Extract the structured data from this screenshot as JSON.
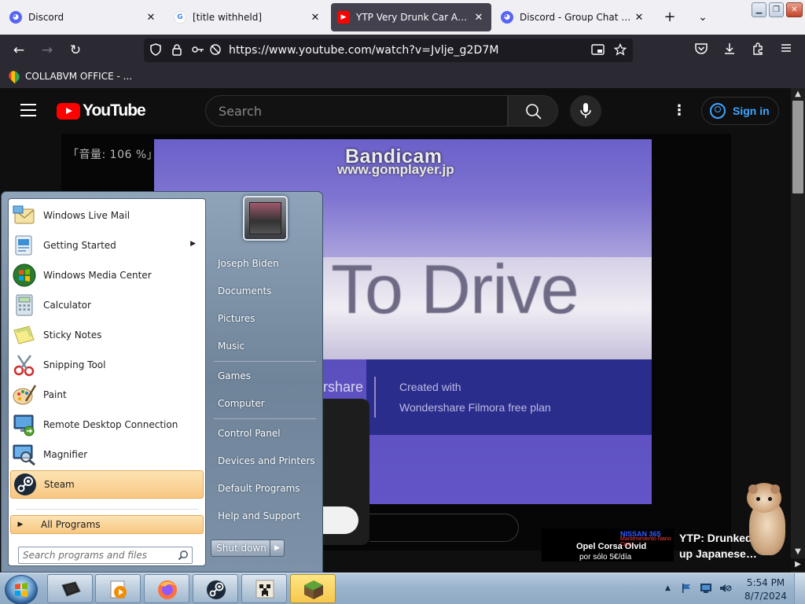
{
  "browser": {
    "tabs": [
      {
        "title": "Discord",
        "icon": "discord-icon",
        "active": false
      },
      {
        "title": "[title withheld]",
        "icon": "google-icon",
        "active": false
      },
      {
        "title": "YTP Very Drunk Car Automo",
        "icon": "youtube-icon",
        "active": true
      },
      {
        "title": "Discord - Group Chat That's",
        "icon": "discord-icon",
        "active": false
      }
    ],
    "tab_close": "✕",
    "new_tab": "+",
    "list_tabs": "⌄",
    "window_controls": {
      "minimize": "▁",
      "restore": "❐",
      "close": "✕"
    },
    "nav": {
      "back": "←",
      "forward": "→",
      "reload": "↻"
    },
    "url": "https://www.youtube.com/watch?v=Jvlje_g2D7M",
    "bookmark": "COLLABVM OFFICE - ...",
    "toolbar_icons": [
      "pocket-icon",
      "download-icon",
      "extensions-icon",
      "menu-icon"
    ]
  },
  "youtube": {
    "logo_text": "YouTube",
    "search_placeholder": "Search",
    "sign_in": "Sign in",
    "more": "⋮",
    "video": {
      "volume_osd": "「音量: 106 %」",
      "watermark1": "Bandicam",
      "watermark2": "www.gomplayer.jp",
      "big_text": "To Drive",
      "brand_fragment": "ershare",
      "created_line1": "Created with",
      "created_line2": "Wondershare Filmora free plan"
    },
    "related": {
      "thumb_line1": "NISSAN 365",
      "thumb_tag": "Mantenimiento Nano Crus",
      "thumb_line2": "Opel Corsa Olvid",
      "thumb_line3": "por sólo 5€/día",
      "title": "YTP: Drunked up Japanese…"
    }
  },
  "start_menu": {
    "programs": [
      {
        "label": "Windows Live Mail",
        "icon": "mail-icon",
        "submenu": false
      },
      {
        "label": "Getting Started",
        "icon": "getting-started-icon",
        "submenu": true
      },
      {
        "label": "Windows Media Center",
        "icon": "media-center-icon",
        "submenu": false
      },
      {
        "label": "Calculator",
        "icon": "calculator-icon",
        "submenu": false
      },
      {
        "label": "Sticky Notes",
        "icon": "sticky-notes-icon",
        "submenu": false
      },
      {
        "label": "Snipping Tool",
        "icon": "snipping-tool-icon",
        "submenu": false
      },
      {
        "label": "Paint",
        "icon": "paint-icon",
        "submenu": false
      },
      {
        "label": "Remote Desktop Connection",
        "icon": "remote-desktop-icon",
        "submenu": false
      },
      {
        "label": "Magnifier",
        "icon": "magnifier-icon",
        "submenu": false
      },
      {
        "label": "Steam",
        "icon": "steam-icon",
        "submenu": false,
        "highlighted": true
      }
    ],
    "all_programs": "All Programs",
    "search_placeholder": "Search programs and files",
    "right_items": [
      "Joseph Biden",
      "Documents",
      "Pictures",
      "Music",
      "Games",
      "Computer",
      "Control Panel",
      "Devices and Printers",
      "Default Programs",
      "Help and Support"
    ],
    "shutdown": "Shut down",
    "shutdown_arrow": "▶"
  },
  "taskbar": {
    "pinned": [
      {
        "name": "terminal-window-icon",
        "active": false
      },
      {
        "name": "media-player-icon",
        "active": false
      },
      {
        "name": "firefox-icon",
        "active": false
      },
      {
        "name": "steam-icon",
        "active": false
      },
      {
        "name": "minecraft-creeper-icon",
        "active": false
      },
      {
        "name": "minecraft-grass-icon",
        "active": true
      }
    ],
    "tray_arrow": "▲",
    "time": "5:54 PM",
    "date": "8/7/2024"
  },
  "colors": {
    "youtube_red": "#ff0000",
    "firefox_tab_active": "#42414d",
    "start_menu_hover": "#f8c782",
    "taskbar_active": "#f6c84b"
  }
}
